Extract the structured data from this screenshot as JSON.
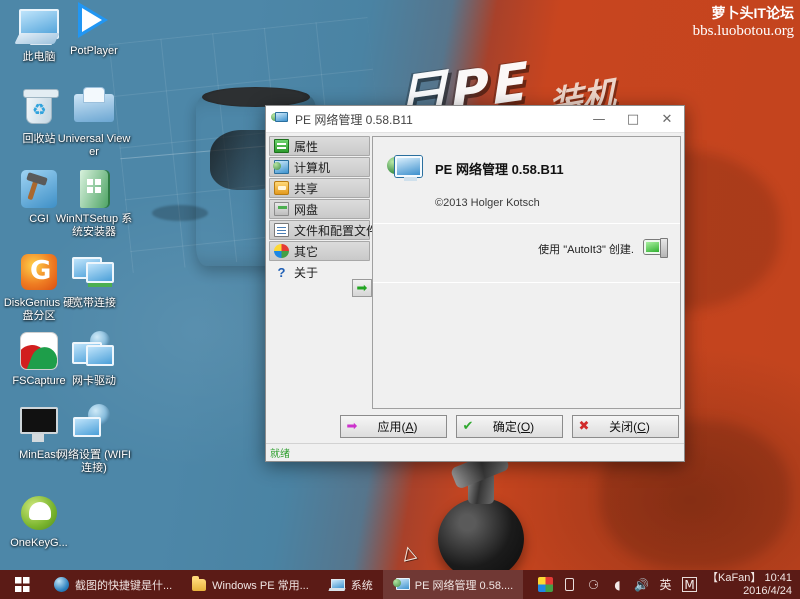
{
  "watermark": {
    "line1": "萝卜头IT论坛",
    "line2": "bbs.luobotou.org"
  },
  "desktop": {
    "icons": [
      {
        "label": "此电脑",
        "icon": "computer-icon"
      },
      {
        "label": "PotPlayer",
        "icon": "potplayer-icon"
      },
      {
        "label": "回收站",
        "icon": "recycle-bin-icon"
      },
      {
        "label": "Universal Viewer",
        "icon": "universal-viewer-icon"
      },
      {
        "label": "CGI",
        "icon": "cgi-icon"
      },
      {
        "label": "WinNTSetup 系统安装器",
        "icon": "winntsetup-icon"
      },
      {
        "label": "DiskGenius 硬盘分区",
        "icon": "diskgenius-icon"
      },
      {
        "label": "宽带连接",
        "icon": "broadband-connection-icon"
      },
      {
        "label": "FSCapture",
        "icon": "fscapture-icon"
      },
      {
        "label": "网卡驱动",
        "icon": "network-driver-icon"
      },
      {
        "label": "MinEast",
        "icon": "mineast-icon"
      },
      {
        "label": "网络设置 (WIFI连接)",
        "icon": "network-settings-icon"
      },
      {
        "label": "OneKeyG...",
        "icon": "onekey-ghost-icon"
      }
    ]
  },
  "dialog": {
    "title": "PE 网络管理 0.58.B11",
    "window_controls": {
      "minimize": "—",
      "maximize": "□",
      "close": "✕"
    },
    "sidebar": [
      {
        "label": "属性",
        "icon": "properties-icon",
        "selected": false
      },
      {
        "label": "计算机",
        "icon": "computer-icon",
        "selected": false
      },
      {
        "label": "共享",
        "icon": "share-icon",
        "selected": false
      },
      {
        "label": "网盘",
        "icon": "net-drive-icon",
        "selected": false
      },
      {
        "label": "文件和配置文件",
        "icon": "files-and-profiles-icon",
        "selected": false
      },
      {
        "label": "其它",
        "icon": "other-icon",
        "selected": false
      },
      {
        "label": "关于",
        "icon": "about-icon",
        "selected": true
      }
    ],
    "expand_button": "➡",
    "about": {
      "app_title": "PE 网络管理 0.58.B11",
      "copyright": "©2013 Holger Kotsch",
      "built_with": "使用 \"AutoIt3\" 创建."
    },
    "buttons": [
      {
        "label_before": "应用(",
        "accel": "A",
        "label_after": ")",
        "icon": "➡",
        "icon_color": "#cc33cc",
        "name": "apply-button"
      },
      {
        "label_before": "确定(",
        "accel": "O",
        "label_after": ")",
        "icon": "✔",
        "icon_color": "#2fa82f",
        "name": "ok-button"
      },
      {
        "label_before": "关闭(",
        "accel": "C",
        "label_after": ")",
        "icon": "✖",
        "icon_color": "#d12b2b",
        "name": "close-button"
      }
    ],
    "status": "就绪"
  },
  "taskbar": {
    "start": "start-button",
    "tasks": [
      {
        "label": "截图的快捷键是什...",
        "icon": "browser-icon",
        "active": false
      },
      {
        "label": "Windows PE 常用...",
        "icon": "folder-icon",
        "active": false
      },
      {
        "label": "系统",
        "icon": "system-icon",
        "active": false
      },
      {
        "label": "PE 网络管理 0.58....",
        "icon": "pe-network-icon",
        "active": true
      }
    ],
    "tray": [
      {
        "name": "color-palette-icon",
        "glyph": ""
      },
      {
        "name": "usb-device-icon",
        "glyph": ""
      },
      {
        "name": "network-icon",
        "glyph": "▄"
      },
      {
        "name": "wifi-icon",
        "glyph": "ᴵ"
      },
      {
        "name": "volume-icon",
        "glyph": "ᵈ"
      },
      {
        "name": "ime-icon",
        "glyph": "英"
      },
      {
        "name": "m-icon",
        "glyph": "M"
      }
    ],
    "clock": {
      "time": "【KaFan】 10:41",
      "date": "2016/4/24"
    }
  },
  "colors": {
    "taskbar_bg": "#5b1b16",
    "wallpaper_blue": "#4d87a8",
    "wallpaper_red": "#c8451f",
    "status_green": "#2e9f2e",
    "accent_apply": "#cc33cc",
    "accent_ok": "#2fa82f",
    "accent_close": "#d12b2b"
  }
}
